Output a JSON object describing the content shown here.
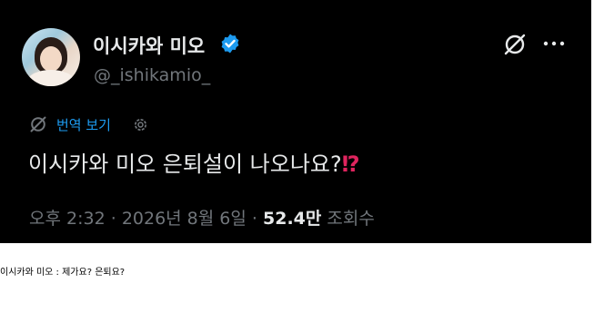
{
  "tweet": {
    "display_name": "이시카와 미오",
    "handle": "@_ishikamio_",
    "translate_label": "번역 보기",
    "text": "이시카와 미오 은퇴설이 나오나요?",
    "text_emoji": "⁉",
    "time": "오후 2:32",
    "separator": "·",
    "date": "2026년 8월 6일",
    "views_count": "52.4만",
    "views_label": "조회수",
    "icons": {
      "verified": "verified-badge-icon",
      "grok": "grok-icon",
      "more": "more-icon",
      "translate": "grok-icon",
      "settings": "gear-icon"
    },
    "colors": {
      "background": "#000000",
      "text": "#e7e9ea",
      "muted": "#71767b",
      "link": "#1d9bf0",
      "verified": "#1d9bf0",
      "emoji": "#e0245e"
    }
  },
  "caption": "이시카와 미오 : 제가요? 은퇴요?"
}
